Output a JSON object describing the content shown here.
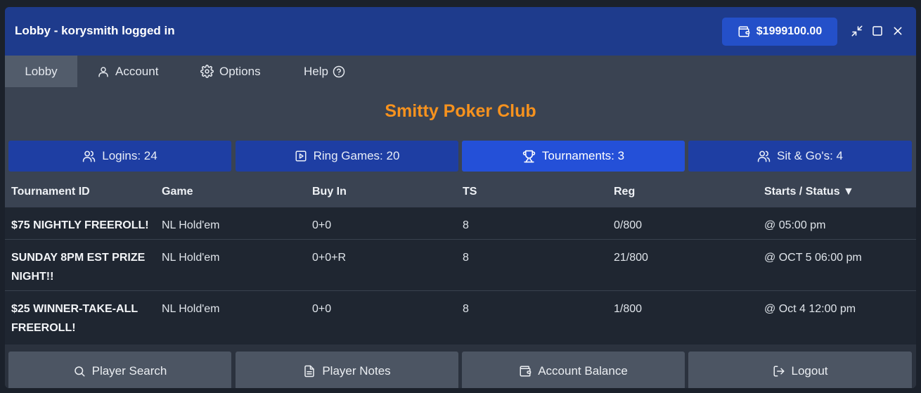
{
  "window": {
    "title": "Lobby - korysmith logged in",
    "balance": "$1999100.00"
  },
  "menu": {
    "lobby": "Lobby",
    "account": "Account",
    "options": "Options",
    "help": "Help"
  },
  "club_name": "Smitty Poker Club",
  "tabs": {
    "logins": "Logins: 24",
    "ring_games": "Ring Games: 20",
    "tournaments": "Tournaments: 3",
    "sit_and_gos": "Sit & Go's: 4"
  },
  "table": {
    "headers": {
      "id": "Tournament ID",
      "game": "Game",
      "buy_in": "Buy In",
      "ts": "TS",
      "reg": "Reg",
      "starts": "Starts / Status ▼"
    },
    "rows": [
      {
        "id": "$75 NIGHTLY FREEROLL!",
        "game": "NL Hold'em",
        "buy_in": "0+0",
        "ts": "8",
        "reg": "0/800",
        "starts": "@ 05:00 pm"
      },
      {
        "id": "SUNDAY 8PM EST PRIZE NIGHT!!",
        "game": "NL Hold'em",
        "buy_in": "0+0+R",
        "ts": "8",
        "reg": "21/800",
        "starts": "@ OCT 5 06:00 pm"
      },
      {
        "id": "$25 WINNER-TAKE-ALL FREEROLL!",
        "game": "NL Hold'em",
        "buy_in": "0+0",
        "ts": "8",
        "reg": "1/800",
        "starts": "@ Oct 4 12:00 pm"
      }
    ]
  },
  "buttons": {
    "player_search": "Player Search",
    "player_notes": "Player Notes",
    "account_balance": "Account Balance",
    "logout": "Logout"
  },
  "colors": {
    "titlebar": "#1e3b8c",
    "accent": "#2450d8",
    "club_title": "#f6921e"
  },
  "icons": [
    "wallet-icon",
    "minimize-icon",
    "maximize-icon",
    "close-icon",
    "user-icon",
    "gear-icon",
    "help-icon",
    "users-icon",
    "play-icon",
    "trophy-icon",
    "search-icon",
    "notes-icon",
    "logout-icon"
  ]
}
